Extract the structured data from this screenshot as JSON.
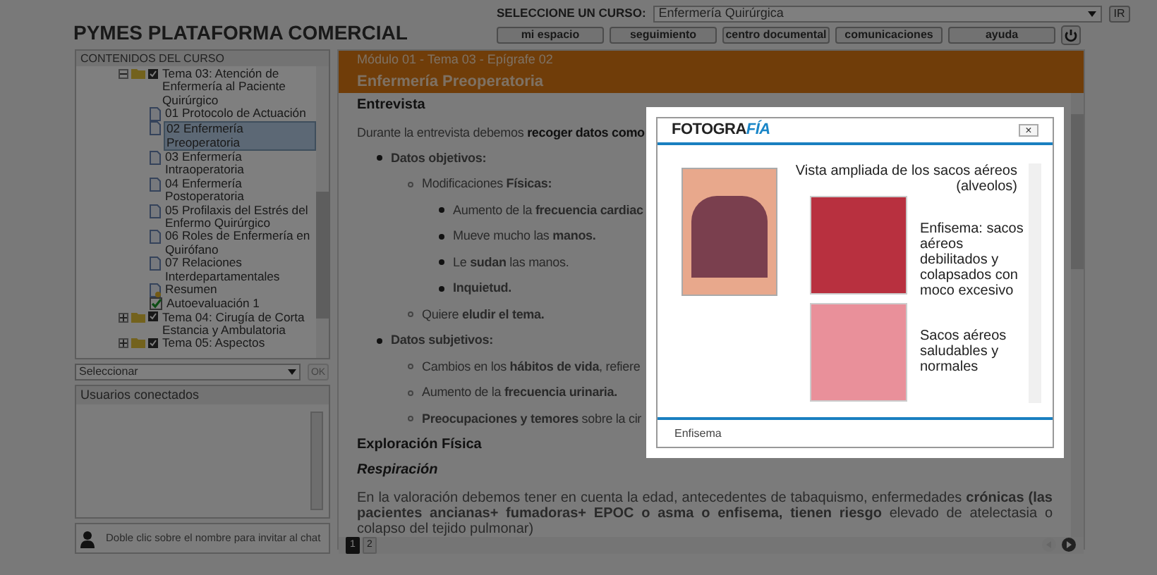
{
  "header": {
    "title": "PYMES PLATAFORMA COMERCIAL",
    "course_label": "SELECCIONE UN CURSO:",
    "course_value": "Enfermería Quirúrgica",
    "go_button": "IR",
    "nav_buttons": [
      "mi espacio",
      "seguimiento",
      "centro documental",
      "comunicaciones",
      "ayuda"
    ]
  },
  "sidebar": {
    "title": "CONTENIDOS DEL CURSO",
    "tree": [
      {
        "kind": "topic",
        "label": "Tema 03: Atención de Enfermería al Paciente Quirúrgico",
        "expanded": true,
        "checked": true,
        "selected": false,
        "children": [
          {
            "kind": "page",
            "label": "01 Protocolo de Actuación",
            "selected": false
          },
          {
            "kind": "page",
            "label": "02 Enfermería Preoperatoria",
            "selected": true
          },
          {
            "kind": "page",
            "label": "03 Enfermería Intraoperatoria",
            "selected": false
          },
          {
            "kind": "page",
            "label": "04 Enfermería Postoperatoria",
            "selected": false
          },
          {
            "kind": "page",
            "label": "05 Profilaxis del Estrés del Enfermo Quirúrgico",
            "selected": false
          },
          {
            "kind": "page",
            "label": "06 Roles de Enfermería en Quirófano",
            "selected": false
          },
          {
            "kind": "page",
            "label": "07 Relaciones Interdepartamentales",
            "selected": false
          },
          {
            "kind": "summary",
            "label": "Resumen",
            "selected": false
          },
          {
            "kind": "test",
            "label": "Autoevaluación 1",
            "selected": false
          }
        ]
      },
      {
        "kind": "topic",
        "label": "Tema 04: Cirugía de Corta Estancia y Ambulatoria",
        "expanded": false,
        "checked": true,
        "selected": false
      },
      {
        "kind": "topic",
        "label": "Tema 05: Aspectos",
        "expanded": false,
        "checked": true,
        "selected": false
      }
    ],
    "select_value": "Seleccionar",
    "ok_button": {
      "label": "OK",
      "disabled": true
    },
    "users_title": "Usuarios conectados",
    "chat_hint": "Doble clic sobre el nombre para invitar al chat"
  },
  "main": {
    "breadcrumb": "Módulo 01 - Tema 03 - Epígrafe 02",
    "title": "Enfermería Preoperatoria",
    "blocks": [
      {
        "kind": "heading",
        "text": "Entrevista"
      },
      {
        "kind": "text",
        "text": "Durante la entrevista debemos **recoger datos como**"
      },
      {
        "kind": "list",
        "items": [
          {
            "text": "**Datos objetivos:**",
            "children": [
              {
                "text": "Modificaciones **Físicas:**",
                "children": [
                  {
                    "text": "Aumento de la **frecuencia cardiac**"
                  },
                  {
                    "text": "Mueve mucho las **manos.**"
                  },
                  {
                    "text": "Le **sudan** las manos."
                  },
                  {
                    "text": "**Inquietud.**"
                  }
                ]
              },
              {
                "text": "Quiere **eludir el tema.**"
              }
            ]
          },
          {
            "text": "**Datos subjetivos:**",
            "children": [
              {
                "text": "Cambios en los **hábitos de vida**, refiere"
              },
              {
                "text": "Aumento de la **frecuencia urinaria.**"
              },
              {
                "text": "**Preocupaciones y temores** sobre la cir"
              }
            ]
          }
        ]
      },
      {
        "kind": "heading",
        "text": "Exploración Física"
      },
      {
        "kind": "subheading",
        "text": "Respiración"
      },
      {
        "kind": "paragraph",
        "text": "En la valoración debemos tener en cuenta la edad, antecedentes de tabaquismo, enfermedades **crónicas (las pacientes ancianas+ fumadoras+ EPOC o asma o enfisema, tienen riesgo** elevado de atelectasia o colapso del tejido pulmonar)"
      }
    ],
    "pages": [
      {
        "label": "1",
        "selected": true
      },
      {
        "label": "2",
        "selected": false
      }
    ],
    "prev_disabled": true
  },
  "modal": {
    "logo": "FOTOGRA",
    "logo_accent": "FÍA",
    "close": "×",
    "zoom_title": "Vista ampliada de los sacos aéreos (alveolos)",
    "captions": [
      "Enfisema: sacos aéreos debilitados y colapsados con moco excesivo",
      "Sacos aéreos saludables y normales"
    ],
    "footer": "Enfisema"
  }
}
